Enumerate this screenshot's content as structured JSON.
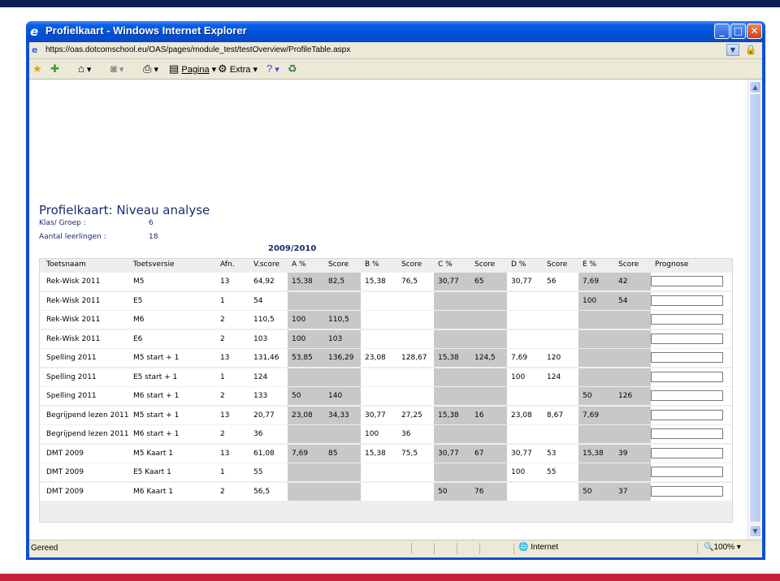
{
  "browser": {
    "window_title": "Profielkaart - Windows Internet Explorer",
    "address": "https://oas.dotcomschool.eu/OAS/pages/module_test/testOverview/ProfileTable.aspx",
    "toolbar": {
      "page_label": "Pagina",
      "extra_label": "Extra"
    },
    "status": {
      "text": "Gereed",
      "zone": "Internet",
      "zoom": "100%"
    }
  },
  "page": {
    "title": "Profielkaart: Niveau analyse",
    "klas_label": "Klas/ Groep :",
    "klas_value": "6",
    "aantal_label": "Aantal leerlingen :",
    "aantal_value": "18",
    "year": "2009/2010"
  },
  "table": {
    "headers": [
      "Toetsnaam",
      "Toetsversie",
      "Afn.",
      "V.score",
      "A %",
      "Score",
      "B %",
      "Score",
      "C %",
      "Score",
      "D %",
      "Score",
      "E %",
      "Score",
      "Prognose"
    ],
    "rows": [
      [
        "Rek-Wisk 2011",
        "M5",
        "13",
        "64,92",
        "15,38",
        "82,5",
        "15,38",
        "76,5",
        "30,77",
        "65",
        "30,77",
        "56",
        "7,69",
        "42"
      ],
      [
        "Rek-Wisk 2011",
        "E5",
        "1",
        "54",
        "",
        "",
        "",
        "",
        "",
        "",
        "",
        "",
        "100",
        "54"
      ],
      [
        "Rek-Wisk 2011",
        "M6",
        "2",
        "110,5",
        "100",
        "110,5",
        "",
        "",
        "",
        "",
        "",
        "",
        "",
        ""
      ],
      [
        "Rek-Wisk 2011",
        "E6",
        "2",
        "103",
        "100",
        "103",
        "",
        "",
        "",
        "",
        "",
        "",
        "",
        ""
      ],
      [
        "Spelling 2011",
        "M5 start + 1",
        "13",
        "131,46",
        "53,85",
        "136,29",
        "23,08",
        "128,67",
        "15,38",
        "124,5",
        "7,69",
        "120",
        "",
        ""
      ],
      [
        "Spelling 2011",
        "E5 start + 1",
        "1",
        "124",
        "",
        "",
        "",
        "",
        "",
        "",
        "100",
        "124",
        "",
        ""
      ],
      [
        "Spelling 2011",
        "M6 start + 1",
        "2",
        "133",
        "50",
        "140",
        "",
        "",
        "",
        "",
        "",
        "",
        "50",
        "126"
      ],
      [
        "Begrijpend lezen 2011",
        "M5 start + 1",
        "13",
        "20,77",
        "23,08",
        "34,33",
        "30,77",
        "27,25",
        "15,38",
        "16",
        "23,08",
        "8,67",
        "7,69",
        ""
      ],
      [
        "Begrijpend lezen 2011",
        "M6 start + 1",
        "2",
        "36",
        "",
        "",
        "100",
        "36",
        "",
        "",
        "",
        "",
        "",
        ""
      ],
      [
        "DMT 2009",
        "M5 Kaart 1",
        "13",
        "61,08",
        "7,69",
        "85",
        "15,38",
        "75,5",
        "30,77",
        "67",
        "30,77",
        "53",
        "15,38",
        "39"
      ],
      [
        "DMT 2009",
        "E5 Kaart 1",
        "1",
        "55",
        "",
        "",
        "",
        "",
        "",
        "",
        "100",
        "55",
        "",
        ""
      ],
      [
        "DMT 2009",
        "M6 Kaart 1",
        "2",
        "56,5",
        "",
        "",
        "",
        "",
        "50",
        "76",
        "",
        "",
        "50",
        "37"
      ]
    ]
  }
}
